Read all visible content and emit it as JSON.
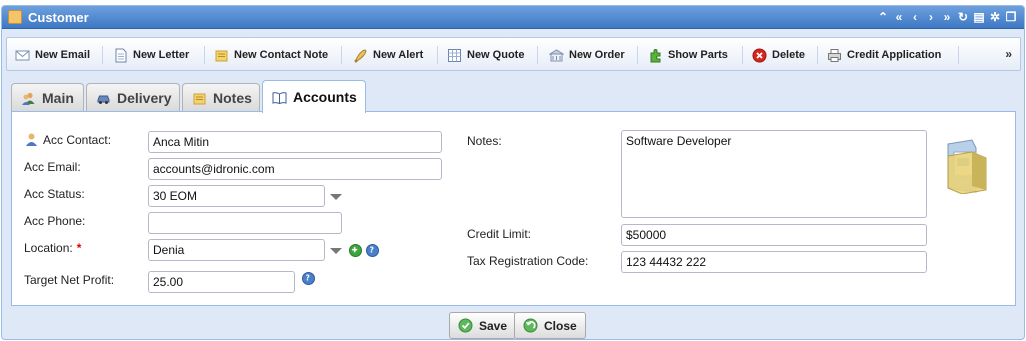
{
  "window": {
    "title": "Customer",
    "title_icon": "customer-icon",
    "tools": [
      "collapse-up-icon",
      "first-icon",
      "prev-icon",
      "next-icon",
      "last-icon",
      "refresh-icon",
      "print-icon",
      "gear-icon",
      "restore-icon"
    ]
  },
  "toolbar": {
    "items": [
      {
        "label": "New Email",
        "icon": "email-icon"
      },
      {
        "label": "New Letter",
        "icon": "letter-icon"
      },
      {
        "label": "New Contact Note",
        "icon": "note-icon"
      },
      {
        "label": "New Alert",
        "icon": "alert-icon"
      },
      {
        "label": "New Quote",
        "icon": "quote-icon"
      },
      {
        "label": "New Order",
        "icon": "order-icon"
      },
      {
        "label": "Show Parts",
        "icon": "parts-icon"
      },
      {
        "label": "Delete",
        "icon": "delete-icon"
      },
      {
        "label": "Credit Application",
        "icon": "printer-icon"
      }
    ],
    "more": "»"
  },
  "tabs": [
    {
      "label": "Main",
      "icon": "users-icon",
      "active": false
    },
    {
      "label": "Delivery",
      "icon": "car-icon",
      "active": false
    },
    {
      "label": "Notes",
      "icon": "note-icon",
      "active": false
    },
    {
      "label": "Accounts",
      "icon": "book-icon",
      "active": true
    }
  ],
  "form": {
    "acc_contact": {
      "label": "Acc Contact:",
      "value": "Anca Mitin",
      "icon": "person-icon"
    },
    "acc_email": {
      "label": "Acc Email:",
      "value": "accounts@idronic.com"
    },
    "acc_status": {
      "label": "Acc Status:",
      "value": "30 EOM"
    },
    "acc_phone": {
      "label": "Acc Phone:",
      "value": ""
    },
    "location": {
      "label": "Location:",
      "required": "*",
      "value": "Denia"
    },
    "target_net_profit": {
      "label": "Target Net Profit:",
      "value": "25.00"
    },
    "notes": {
      "label": "Notes:",
      "value": "Software Developer"
    },
    "credit_limit": {
      "label": "Credit Limit:",
      "value": "$50000"
    },
    "tax_registration": {
      "label": "Tax Registration Code:",
      "value": "123 44432 222"
    }
  },
  "buttons": {
    "save": "Save",
    "close": "Close"
  },
  "colors": {
    "title_bar": "#3e78c4",
    "panel_border": "#99bbe8",
    "window_bg": "#dfe8f6",
    "add_green": "#3ea53e",
    "help_blue": "#4a7fc9",
    "delete_red": "#d9261c"
  }
}
